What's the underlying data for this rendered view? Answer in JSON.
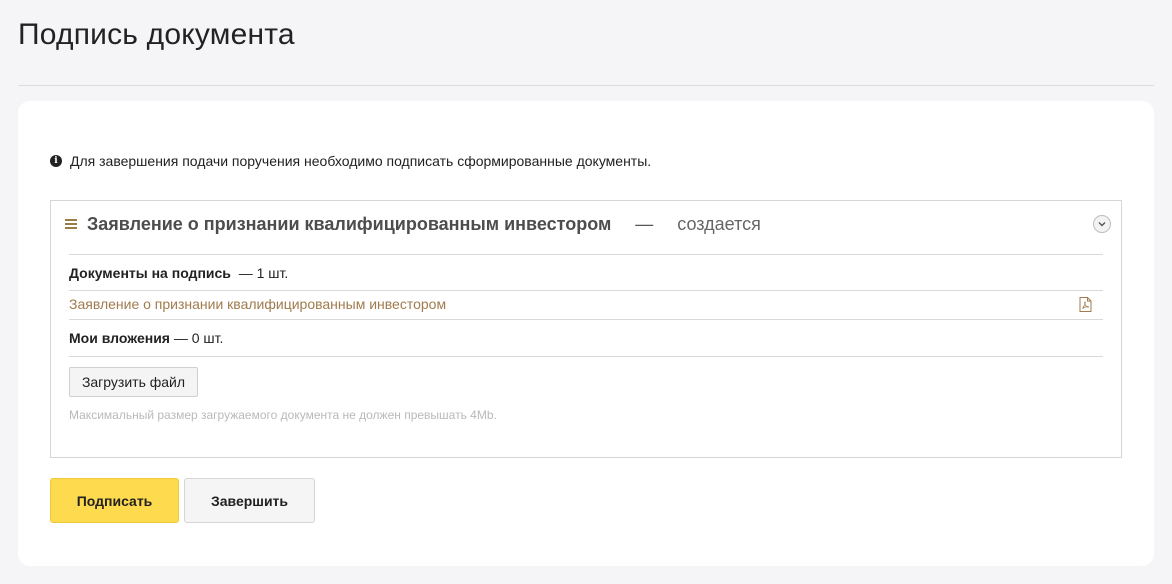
{
  "page": {
    "title": "Подпись документа"
  },
  "info": {
    "icon": "info-circle-icon",
    "text": "Для завершения подачи поручения необходимо подписать сформированные документы."
  },
  "document": {
    "menu_icon": "hamburger-icon",
    "title": "Заявление о признании квалифицированным инвестором",
    "dash": "—",
    "status": "создается",
    "expand_icon": "chevron-down-icon",
    "docs_to_sign": {
      "label": "Документы на подпись",
      "count": "— 1 шт."
    },
    "files": [
      {
        "name": "Заявление о признании квалифицированным инвестором",
        "icon": "pdf-icon"
      }
    ],
    "attachments": {
      "label": "Мои вложения",
      "count": "— 0 шт."
    },
    "upload_button": "Загрузить файл",
    "upload_hint": "Максимальный размер загружаемого документа не должен превышать 4Mb."
  },
  "actions": {
    "sign_label": "Подписать",
    "finish_label": "Завершить"
  },
  "colors": {
    "accent_yellow": "#fdda4e",
    "link_brown": "#a07b4d"
  }
}
